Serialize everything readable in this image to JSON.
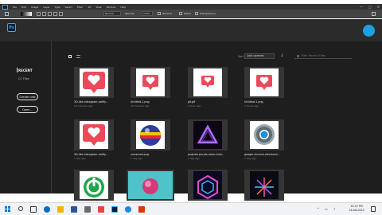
{
  "menubar": {
    "items": [
      "File",
      "Edit",
      "Image",
      "Layer",
      "Type",
      "Select",
      "Filter",
      "3D",
      "View",
      "Window",
      "Help"
    ],
    "window_buttons": [
      "—",
      "□",
      "✕"
    ]
  },
  "optbar": {
    "mode_value": "Normal",
    "opacity_label": "Opacity:",
    "opacity_value": "100%",
    "reverse_label": "Reverse",
    "dither_label": "Dither",
    "transparency_label": "Transparency"
  },
  "app": {
    "logo_text": "Ps"
  },
  "sidebar": {
    "recent_label": "RECENT",
    "cc_files_label": "CC Files",
    "create_new_label": "Create new",
    "open_label": "Open..."
  },
  "toolbar": {
    "sort_label": "Sort",
    "sort_value": "Last opened",
    "sort_direction": "↓",
    "filter_placeholder": "Filter Recent Files"
  },
  "files": [
    {
      "name": "3D-like-instagram-notify...",
      "date": "19 minutes ago",
      "thumb": "heart-notify"
    },
    {
      "name": "Untitled-1.png",
      "date": "20 minutes ago",
      "thumb": "heart-notify-small"
    },
    {
      "name": "gif.gif",
      "date": "1 hour ago",
      "thumb": "heart-notify-small"
    },
    {
      "name": "Untitled-1.png",
      "date": "7 hours ago",
      "thumb": "heart-notify-small"
    },
    {
      "name": "3D-like-instagram-notify...",
      "date": "1 day ago",
      "thumb": "heart-notify"
    },
    {
      "name": "unnamed.png",
      "date": "1 day ago",
      "thumb": "glass-ball"
    },
    {
      "name": "pngtree-purple-neon-trian...",
      "date": "1 day ago",
      "thumb": "neon-triangle"
    },
    {
      "name": "google-chrome-electronic...",
      "date": "1 day ago",
      "thumb": "chrome-ring"
    },
    {
      "name": "",
      "date": "",
      "thumb": "power-green"
    },
    {
      "name": "",
      "date": "",
      "thumb": "teal-swirl"
    },
    {
      "name": "",
      "date": "",
      "thumb": "neon-cube"
    },
    {
      "name": "",
      "date": "",
      "thumb": "neon-burst"
    }
  ],
  "taskbar": {
    "time": "10:22 PM",
    "date": "16-06-2020",
    "tray_icons": [
      "^",
      "▭",
      "♪"
    ]
  },
  "colors": {
    "accent": "#31a8ff",
    "heart_red": "#e94b5b",
    "cloud_blue": "#1ba1e2"
  }
}
